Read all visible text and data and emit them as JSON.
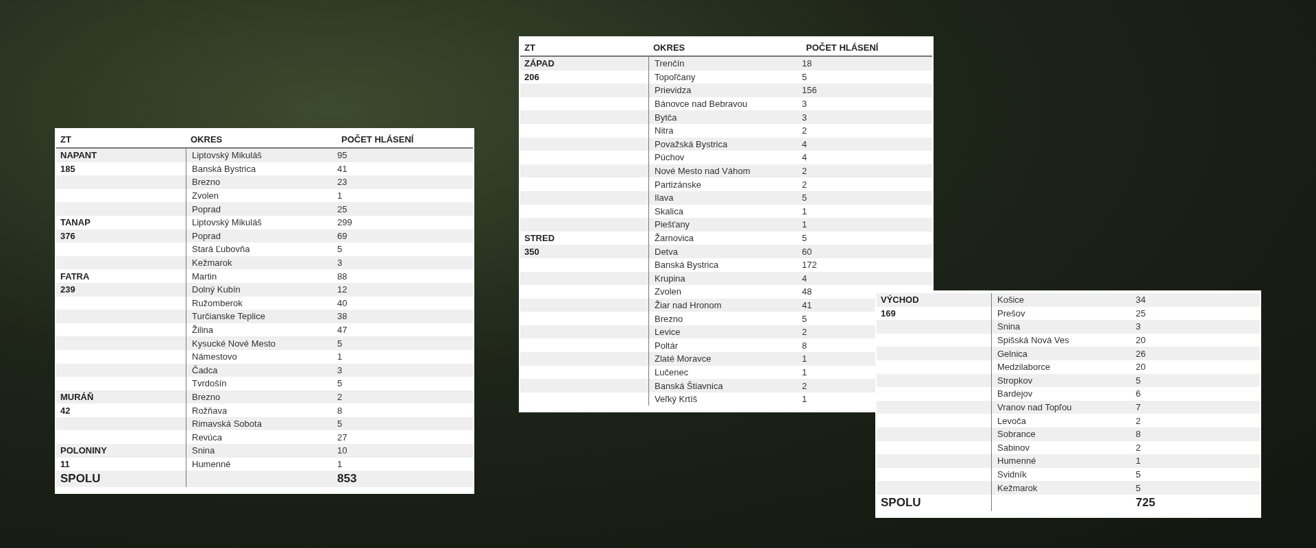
{
  "tables": [
    {
      "columns": [
        "ZT",
        "OKRES",
        "POČET HLÁSENÍ"
      ],
      "groups": [
        {
          "zt": "NAPANT",
          "total": "185",
          "rows": [
            {
              "okres": "Liptovský Mikuláš",
              "count": "95"
            },
            {
              "okres": "Banská Bystrica",
              "count": "41"
            },
            {
              "okres": "Brezno",
              "count": "23"
            },
            {
              "okres": "Zvolen",
              "count": "1"
            },
            {
              "okres": "Poprad",
              "count": "25"
            }
          ]
        },
        {
          "zt": "TANAP",
          "total": "376",
          "rows": [
            {
              "okres": "Liptovský Mikuláš",
              "count": "299"
            },
            {
              "okres": "Poprad",
              "count": "69"
            },
            {
              "okres": "Stará Ľubovňa",
              "count": "5"
            },
            {
              "okres": "Kežmarok",
              "count": "3"
            }
          ]
        },
        {
          "zt": "FATRA",
          "total": "239",
          "rows": [
            {
              "okres": "Martin",
              "count": "88"
            },
            {
              "okres": "Dolný Kubín",
              "count": "12"
            },
            {
              "okres": "Ružomberok",
              "count": "40"
            },
            {
              "okres": "Turčianske Teplice",
              "count": "38"
            },
            {
              "okres": "Žilina",
              "count": "47"
            },
            {
              "okres": "Kysucké Nové Mesto",
              "count": "5"
            },
            {
              "okres": "Námestovo",
              "count": "1"
            },
            {
              "okres": "Čadca",
              "count": "3"
            },
            {
              "okres": "Tvrdošín",
              "count": "5"
            }
          ]
        },
        {
          "zt": "MURÁŇ",
          "total": "42",
          "rows": [
            {
              "okres": "Brezno",
              "count": "2"
            },
            {
              "okres": "Rožňava",
              "count": "8"
            },
            {
              "okres": "Rimavská Sobota",
              "count": "5"
            },
            {
              "okres": "Revúca",
              "count": "27"
            }
          ]
        },
        {
          "zt": "POLONINY",
          "total": "11",
          "rows": [
            {
              "okres": "Snina",
              "count": "10"
            },
            {
              "okres": "Humenné",
              "count": "1"
            }
          ]
        }
      ],
      "total": {
        "label": "SPOLU",
        "value": "853"
      }
    },
    {
      "columns": [
        "ZT",
        "OKRES",
        "POČET HLÁSENÍ"
      ],
      "groups": [
        {
          "zt": "ZÁPAD",
          "total": "206",
          "rows": [
            {
              "okres": "Trenčín",
              "count": "18"
            },
            {
              "okres": "Topoľčany",
              "count": "5"
            },
            {
              "okres": "Prievidza",
              "count": "156"
            },
            {
              "okres": "Bánovce nad Bebravou",
              "count": "3"
            },
            {
              "okres": "Bytča",
              "count": "3"
            },
            {
              "okres": "Nitra",
              "count": "2"
            },
            {
              "okres": "Považská Bystrica",
              "count": "4"
            },
            {
              "okres": "Púchov",
              "count": "4"
            },
            {
              "okres": "Nové Mesto nad Váhom",
              "count": "2"
            },
            {
              "okres": "Partizánske",
              "count": "2"
            },
            {
              "okres": "Ilava",
              "count": "5"
            },
            {
              "okres": "Skalica",
              "count": "1"
            },
            {
              "okres": "Piešťany",
              "count": "1"
            }
          ]
        },
        {
          "zt": "STRED",
          "total": "350",
          "rows": [
            {
              "okres": "Žarnovica",
              "count": "5"
            },
            {
              "okres": "Detva",
              "count": "60"
            },
            {
              "okres": "Banská Bystrica",
              "count": "172"
            },
            {
              "okres": "Krupina",
              "count": "4"
            },
            {
              "okres": "Zvolen",
              "count": "48"
            },
            {
              "okres": "Žiar nad Hronom",
              "count": "41"
            },
            {
              "okres": "Brezno",
              "count": "5"
            },
            {
              "okres": "Levice",
              "count": "2"
            },
            {
              "okres": "Poltár",
              "count": "8"
            },
            {
              "okres": "Zlaté Moravce",
              "count": "1"
            },
            {
              "okres": "Lučenec",
              "count": "1"
            },
            {
              "okres": "Banská Štiavnica",
              "count": "2"
            },
            {
              "okres": "Veľký Krtíš",
              "count": "1"
            }
          ]
        }
      ]
    },
    {
      "groups": [
        {
          "zt": "VÝCHOD",
          "total": "169",
          "rows": [
            {
              "okres": "Košice",
              "count": "34"
            },
            {
              "okres": "Prešov",
              "count": "25"
            },
            {
              "okres": "Snina",
              "count": "3"
            },
            {
              "okres": "Spišská Nová Ves",
              "count": "20"
            },
            {
              "okres": "Gelnica",
              "count": "26"
            },
            {
              "okres": "Medzilaborce",
              "count": "20"
            },
            {
              "okres": "Stropkov",
              "count": "5"
            },
            {
              "okres": "Bardejov",
              "count": "6"
            },
            {
              "okres": "Vranov nad Topľou",
              "count": "7"
            },
            {
              "okres": "Levoča",
              "count": "2"
            },
            {
              "okres": "Sobrance",
              "count": "8"
            },
            {
              "okres": "Sabinov",
              "count": "2"
            },
            {
              "okres": "Humenné",
              "count": "1"
            },
            {
              "okres": "Svidník",
              "count": "5"
            },
            {
              "okres": "Kežmarok",
              "count": "5"
            }
          ]
        }
      ],
      "total": {
        "label": "SPOLU",
        "value": "725"
      }
    }
  ]
}
